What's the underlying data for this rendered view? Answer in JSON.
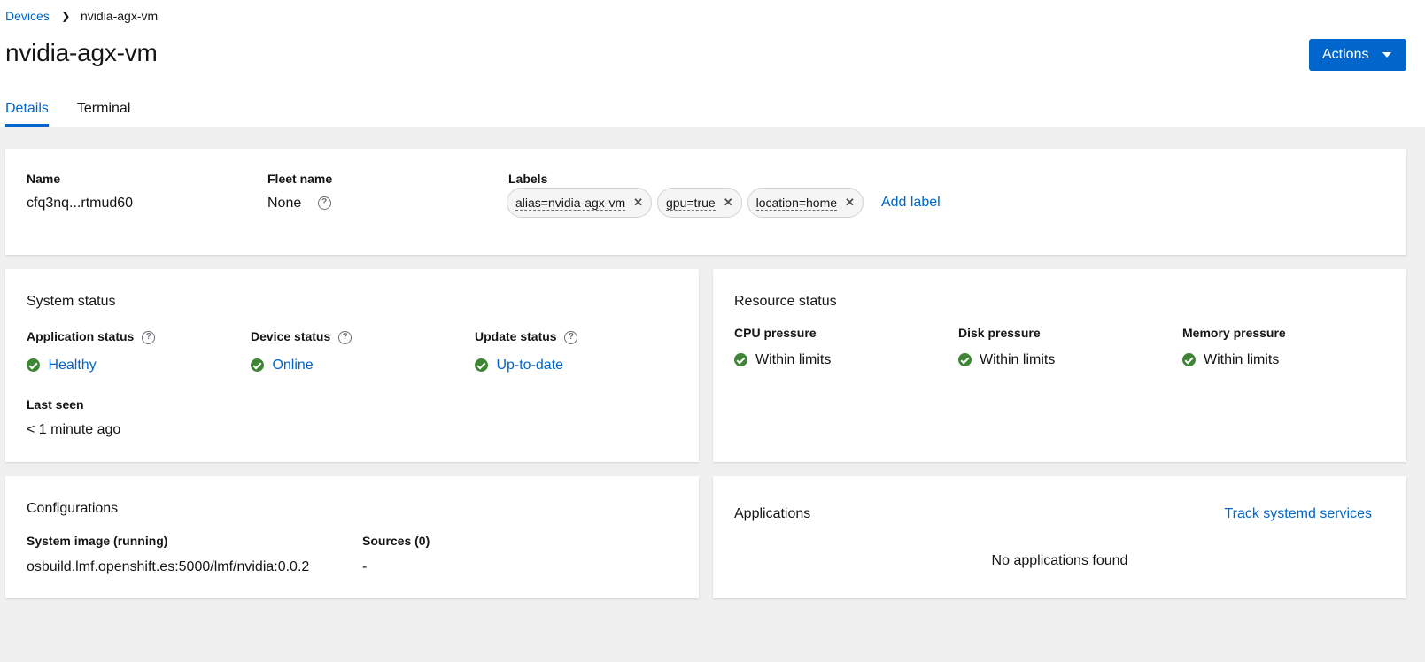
{
  "breadcrumb": {
    "parent": "Devices",
    "current": "nvidia-agx-vm"
  },
  "page": {
    "title": "nvidia-agx-vm",
    "actions_label": "Actions"
  },
  "tabs": [
    {
      "label": "Details",
      "active": true
    },
    {
      "label": "Terminal",
      "active": false
    }
  ],
  "details": {
    "name_label": "Name",
    "name_value": "cfq3nq...rtmud60",
    "fleet_label": "Fleet name",
    "fleet_value": "None",
    "labels_label": "Labels",
    "labels": [
      "alias=nvidia-agx-vm",
      "gpu=true",
      "location=home"
    ],
    "add_label": "Add label"
  },
  "system_status": {
    "title": "System status",
    "application_label": "Application status",
    "application_value": "Healthy",
    "device_label": "Device status",
    "device_value": "Online",
    "update_label": "Update status",
    "update_value": "Up-to-date",
    "last_seen_label": "Last seen",
    "last_seen_value": "< 1 minute ago"
  },
  "resource_status": {
    "title": "Resource status",
    "cpu_label": "CPU pressure",
    "cpu_value": "Within limits",
    "disk_label": "Disk pressure",
    "disk_value": "Within limits",
    "memory_label": "Memory pressure",
    "memory_value": "Within limits"
  },
  "configurations": {
    "title": "Configurations",
    "system_image_label": "System image (running)",
    "system_image_value": "osbuild.lmf.openshift.es:5000/lmf/nvidia:0.0.2",
    "sources_label": "Sources (0)",
    "sources_value": "-"
  },
  "applications": {
    "title": "Applications",
    "track_link": "Track systemd services",
    "empty_text": "No applications found"
  },
  "colors": {
    "accent": "#0066cc",
    "success": "#3e8635",
    "background": "#f0f0f0"
  }
}
